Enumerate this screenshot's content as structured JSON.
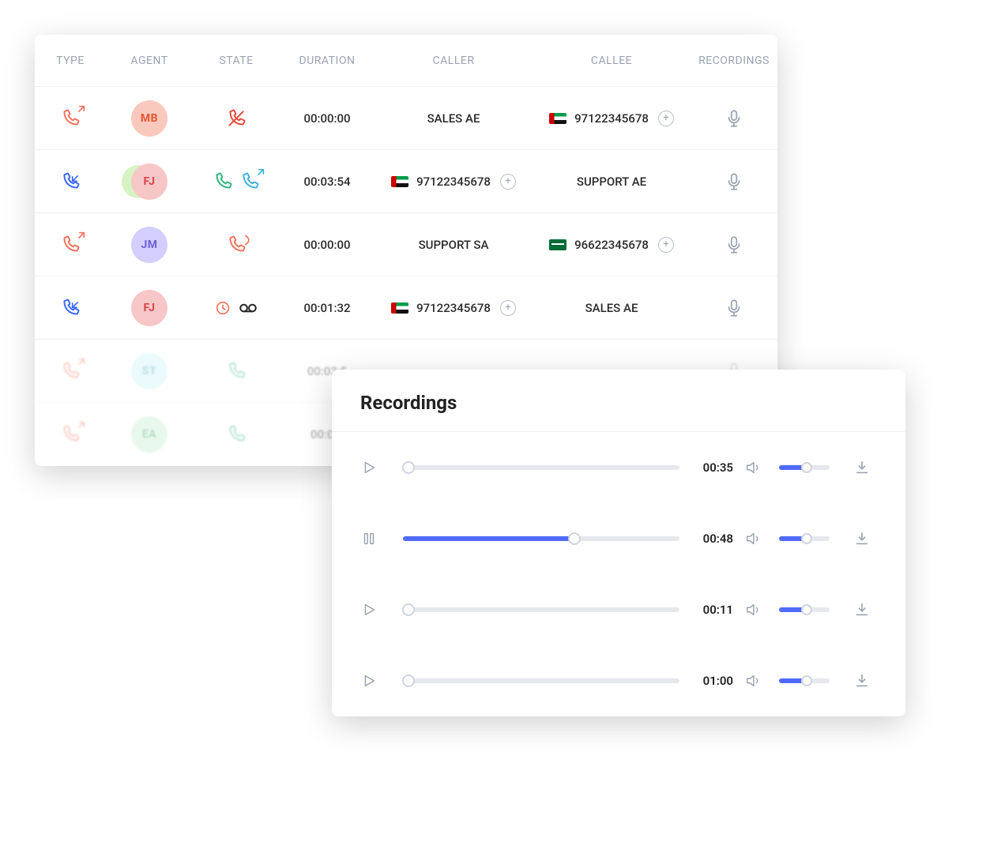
{
  "table": {
    "headers": {
      "type": "TYPE",
      "agent": "AGENT",
      "state": "STATE",
      "duration": "DURATION",
      "caller": "CALLER",
      "callee": "CALLEE",
      "recordings": "RECORDINGS"
    },
    "rows": [
      {
        "type": "outgoing",
        "agent": {
          "initials": "MB",
          "bg": "#f9c9bd",
          "fg": "#e4572e",
          "secondary": false
        },
        "state": "missed",
        "duration": "00:00:00",
        "caller": {
          "label": "SALES AE",
          "flag": null,
          "plus": false
        },
        "callee": {
          "label": "97122345678",
          "flag": "ae",
          "plus": true
        }
      },
      {
        "type": "incoming",
        "agent": {
          "initials": "FJ",
          "bg": "#f7c7c7",
          "fg": "#d64545",
          "secondary": true
        },
        "state": "answered_transferred",
        "duration": "00:03:54",
        "caller": {
          "label": "97122345678",
          "flag": "ae",
          "plus": true
        },
        "callee": {
          "label": "SUPPORT AE",
          "flag": null,
          "plus": false
        }
      },
      {
        "type": "outgoing",
        "agent": {
          "initials": "JM",
          "bg": "#d4ceff",
          "fg": "#6b63d6",
          "secondary": false
        },
        "state": "ringing",
        "duration": "00:00:00",
        "caller": {
          "label": "SUPPORT SA",
          "flag": null,
          "plus": false
        },
        "callee": {
          "label": "96622345678",
          "flag": "sa",
          "plus": true
        }
      },
      {
        "type": "incoming",
        "agent": {
          "initials": "FJ",
          "bg": "#f7c7c7",
          "fg": "#d64545",
          "secondary": false
        },
        "state": "voicemail",
        "duration": "00:01:32",
        "caller": {
          "label": "97122345678",
          "flag": "ae",
          "plus": true
        },
        "callee": {
          "label": "SALES AE",
          "flag": null,
          "plus": false
        }
      },
      {
        "type": "outgoing",
        "agent": {
          "initials": "ST",
          "bg": "#c7f1f7",
          "fg": "#3aa6b9",
          "secondary": false
        },
        "state": "answered",
        "duration": "00:03:5",
        "caller": {
          "label": "",
          "flag": null,
          "plus": false
        },
        "callee": {
          "label": "",
          "flag": null,
          "plus": false
        },
        "faded": true
      },
      {
        "type": "outgoing",
        "agent": {
          "initials": "EA",
          "bg": "#bfeccd",
          "fg": "#2f9e5b",
          "secondary": false
        },
        "state": "answered",
        "duration": "00:03:",
        "caller": {
          "label": "",
          "flag": null,
          "plus": false
        },
        "callee": {
          "label": "",
          "flag": null,
          "plus": false
        },
        "faded": true
      }
    ]
  },
  "recordings": {
    "title": "Recordings",
    "items": [
      {
        "playing": false,
        "progress": 0.02,
        "time": "00:35",
        "volume": 0.55
      },
      {
        "playing": true,
        "progress": 0.62,
        "time": "00:48",
        "volume": 0.55
      },
      {
        "playing": false,
        "progress": 0.02,
        "time": "00:11",
        "volume": 0.55
      },
      {
        "playing": false,
        "progress": 0.02,
        "time": "01:00",
        "volume": 0.55
      }
    ]
  },
  "colors": {
    "outgoing": "#f4715b",
    "incoming": "#3a66ff",
    "answered": "#2fb67c",
    "ringing": "#f4715b",
    "missed": "#e4483b",
    "transfer": "#3fb0d6",
    "clock": "#f4715b",
    "accent": "#4f6af6",
    "muted": "#9aa3b2"
  }
}
